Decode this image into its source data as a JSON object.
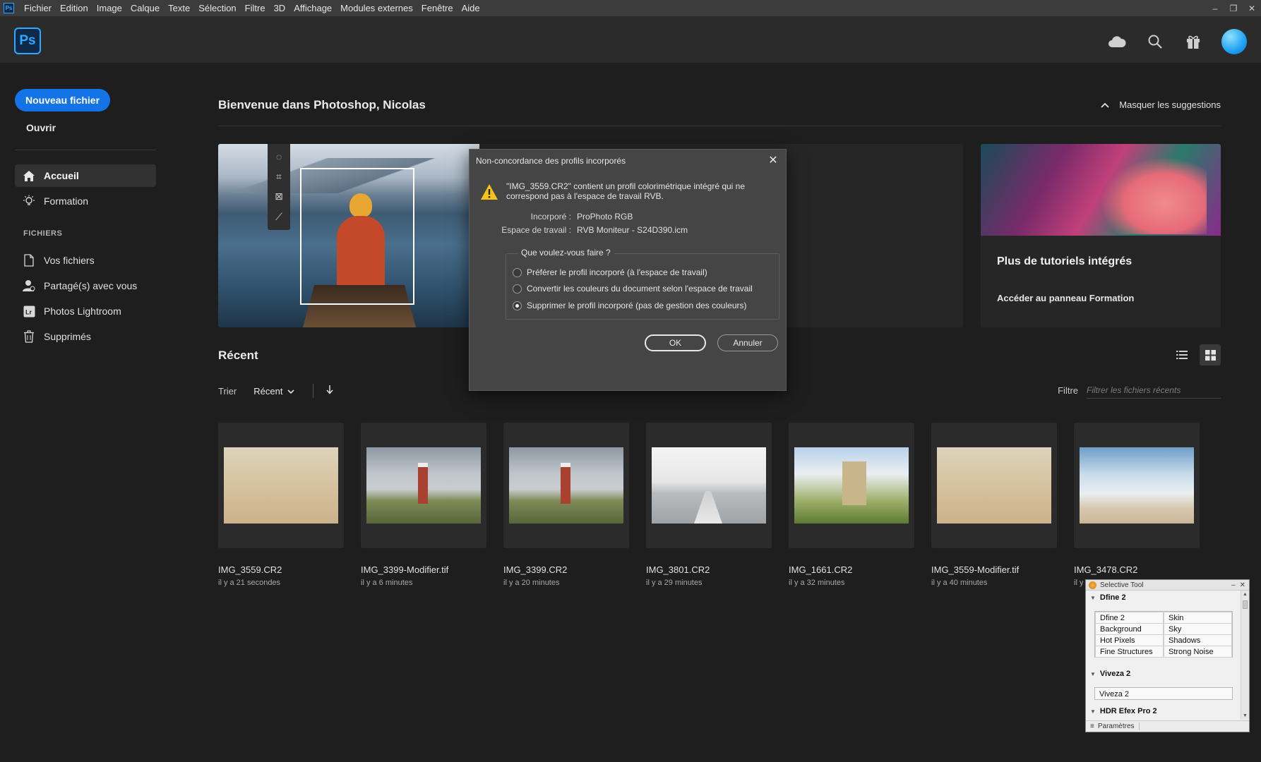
{
  "menubar": {
    "app_icon": "Ps",
    "items": [
      "Fichier",
      "Edition",
      "Image",
      "Calque",
      "Texte",
      "Sélection",
      "Filtre",
      "3D",
      "Affichage",
      "Modules externes",
      "Fenêtre",
      "Aide"
    ],
    "window_controls": [
      "–",
      "❐",
      "✕"
    ]
  },
  "header": {
    "logo": "Ps",
    "icons": [
      "cloud-icon",
      "search-icon",
      "gift-icon",
      "avatar"
    ],
    "accent": "#31a8ff"
  },
  "sidebar": {
    "new_file": "Nouveau fichier",
    "open": "Ouvrir",
    "nav": [
      {
        "label": "Accueil",
        "icon": "home-icon",
        "active": true
      },
      {
        "label": "Formation",
        "icon": "lightbulb-icon",
        "active": false
      }
    ],
    "files_heading": "FICHIERS",
    "files": [
      {
        "label": "Vos fichiers",
        "icon": "file-icon"
      },
      {
        "label": "Partagé(s) avec vous",
        "icon": "shared-user-icon"
      },
      {
        "label": "Photos Lightroom",
        "icon": "lightroom-icon"
      },
      {
        "label": "Supprimés",
        "icon": "trash-icon"
      }
    ],
    "accent": "#1473e6"
  },
  "main": {
    "welcome": "Bienvenue dans Photoshop, Nicolas",
    "hide_suggestions": "Masquer les suggestions",
    "tutorial_card": {
      "title": "Plus de tutoriels intégrés",
      "link": "Accéder au panneau Formation"
    },
    "recent": {
      "title": "Récent",
      "sort_label": "Trier",
      "sort_value": "Récent",
      "filter_label": "Filtre",
      "filter_placeholder": "Filtrer les fichiers récents",
      "files": [
        {
          "name": "IMG_3559.CR2",
          "time": "il y a 21 secondes",
          "thumb": "beach"
        },
        {
          "name": "IMG_3399-Modifier.tif",
          "time": "il y a 6 minutes",
          "thumb": "lighthouse"
        },
        {
          "name": "IMG_3399.CR2",
          "time": "il y a 20 minutes",
          "thumb": "lighthouse"
        },
        {
          "name": "IMG_3801.CR2",
          "time": "il y a 29 minutes",
          "thumb": "pier"
        },
        {
          "name": "IMG_1661.CR2",
          "time": "il y a 32 minutes",
          "thumb": "ruin"
        },
        {
          "name": "IMG_3559-Modifier.tif",
          "time": "il y a 40 minutes",
          "thumb": "beach"
        },
        {
          "name": "IMG_3478.CR2",
          "time": "il y",
          "thumb": "sky"
        }
      ]
    }
  },
  "dialog": {
    "title": "Non-concordance des profils incorporés",
    "message": "\"IMG_3559.CR2\" contient un profil colorimétrique intégré qui ne correspond pas à l'espace de travail RVB.",
    "embedded_label": "Incorporé :",
    "embedded_value": "ProPhoto RGB",
    "working_label": "Espace de travail :",
    "working_value": "RVB Moniteur - S24D390.icm",
    "question": "Que voulez-vous faire ?",
    "options": [
      {
        "label": "Préférer le profil incorporé (à l'espace de travail)",
        "checked": false
      },
      {
        "label": "Convertir les couleurs du document selon l'espace de travail",
        "checked": false
      },
      {
        "label": "Supprimer le profil incorporé (pas de gestion des couleurs)",
        "checked": true
      }
    ],
    "ok": "OK",
    "cancel": "Annuler"
  },
  "selective_tool": {
    "title": "Selective Tool",
    "sections": [
      {
        "name": "Dfine 2",
        "items": [
          "Dfine 2",
          "Skin",
          "Background",
          "Sky",
          "Hot Pixels",
          "Shadows",
          "Fine Structures",
          "Strong Noise"
        ]
      },
      {
        "name": "Viveza 2",
        "items": [
          "Viveza 2"
        ]
      },
      {
        "name": "HDR Efex Pro 2",
        "items": []
      }
    ],
    "footer_tab": "Paramètres"
  }
}
